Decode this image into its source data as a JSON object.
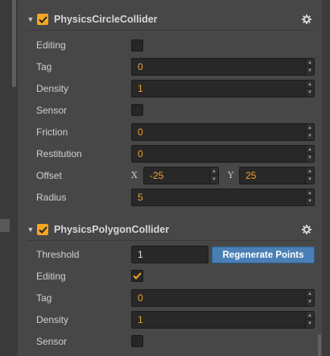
{
  "colors": {
    "accent": "#f5a623",
    "value_text": "#f0a030",
    "button": "#4a7fb5"
  },
  "sections": [
    {
      "title": "PhysicsCircleCollider",
      "enabled": true,
      "rows": {
        "editing": {
          "label": "Editing",
          "checked": false
        },
        "tag": {
          "label": "Tag",
          "value": "0"
        },
        "density": {
          "label": "Density",
          "value": "1"
        },
        "sensor": {
          "label": "Sensor",
          "checked": false
        },
        "friction": {
          "label": "Friction",
          "value": "0"
        },
        "restitution": {
          "label": "Restitution",
          "value": "0"
        },
        "offset": {
          "label": "Offset",
          "x_label": "X",
          "x_value": "-25",
          "y_label": "Y",
          "y_value": "25"
        },
        "radius": {
          "label": "Radius",
          "value": "5"
        }
      }
    },
    {
      "title": "PhysicsPolygonCollider",
      "enabled": true,
      "rows": {
        "threshold": {
          "label": "Threshold",
          "value": "1",
          "button": "Regenerate Points"
        },
        "editing": {
          "label": "Editing",
          "checked": true
        },
        "tag": {
          "label": "Tag",
          "value": "0"
        },
        "density": {
          "label": "Density",
          "value": "1"
        },
        "sensor": {
          "label": "Sensor",
          "checked": false
        }
      }
    }
  ]
}
